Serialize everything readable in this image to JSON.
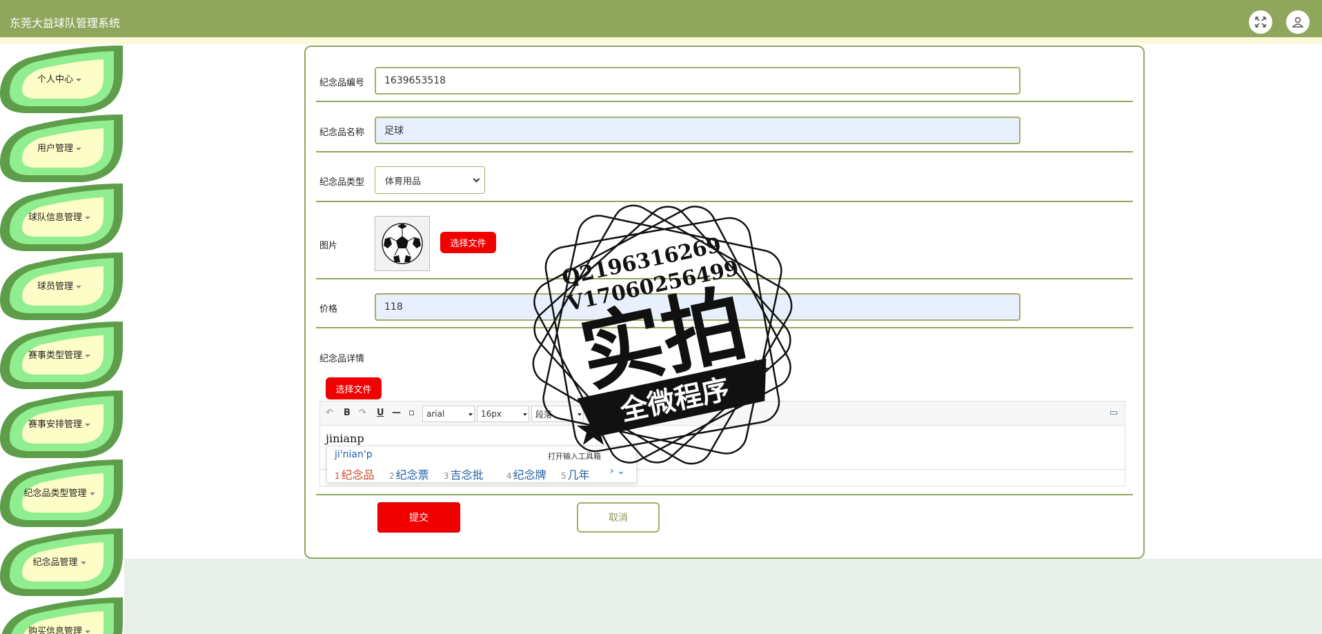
{
  "app": {
    "title": "东莞大益球队管理系统"
  },
  "header": {
    "fullscreen_icon": "fullscreen-icon",
    "user_icon": "user-icon"
  },
  "sidebar": {
    "items": [
      {
        "label": "个人中心"
      },
      {
        "label": "用户管理"
      },
      {
        "label": "球队信息管理"
      },
      {
        "label": "球员管理"
      },
      {
        "label": "赛事类型管理"
      },
      {
        "label": "赛事安排管理"
      },
      {
        "label": "纪念品类型管理"
      },
      {
        "label": "纪念品管理"
      },
      {
        "label": "购买信息管理"
      }
    ]
  },
  "form": {
    "code": {
      "label": "纪念品编号",
      "value": "1639653518"
    },
    "name": {
      "label": "纪念品名称",
      "value": "足球"
    },
    "type": {
      "label": "纪念品类型",
      "value": "体育用品"
    },
    "image": {
      "label": "图片",
      "button": "选择文件"
    },
    "price": {
      "label": "价格",
      "value": "118"
    },
    "detail": {
      "label": "纪念品详情",
      "button": "选择文件"
    }
  },
  "editor": {
    "font_family": "arial",
    "font_size": "16px",
    "paragraph": "段落",
    "typed_text": "jinianp"
  },
  "ime": {
    "pinyin": "ji'nian'p",
    "toolbox": "打开输入工具箱",
    "candidates": [
      "纪念品",
      "纪念票",
      "吉念批",
      "纪念牌",
      "几年"
    ]
  },
  "buttons": {
    "submit": "提交",
    "cancel": "取消"
  },
  "watermark": {
    "line1": "Q2196316269",
    "line2": "V17060256499",
    "main": "实拍",
    "banner": "全微程序"
  },
  "colors": {
    "header": "#8fa75c",
    "accent_red": "#f10000",
    "border_olive": "#a3ad6b",
    "sidebar_green": "#90ee90"
  }
}
